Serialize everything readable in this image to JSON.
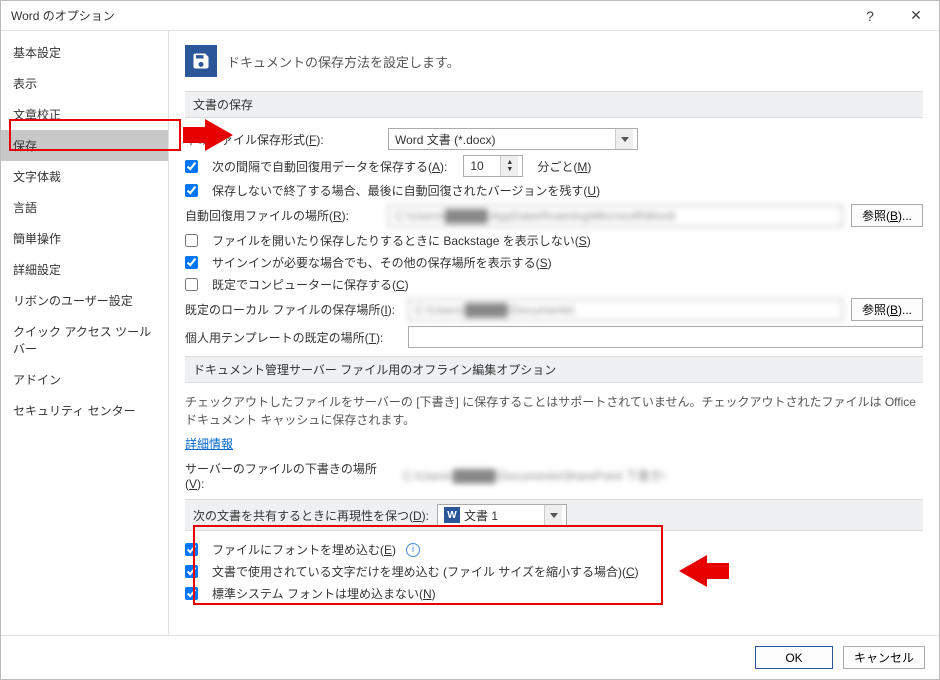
{
  "window": {
    "title": "Word のオプション",
    "help_tooltip": "?",
    "close_tooltip": "✕"
  },
  "sidebar": {
    "items": [
      "基本設定",
      "表示",
      "文章校正",
      "保存",
      "文字体裁",
      "言語",
      "簡単操作",
      "詳細設定",
      "リボンのユーザー設定",
      "クイック アクセス ツール バー",
      "アドイン",
      "セキュリティ センター"
    ],
    "selected_index": 3
  },
  "header": {
    "text": "ドキュメントの保存方法を設定します。"
  },
  "section_save": {
    "title": "文書の保存",
    "file_format_label_pre": "準のファイル保存形式(",
    "file_format_hot": "F",
    "file_format_label_post": "):",
    "file_format_value": "Word 文書 (*.docx)",
    "autorecover_label_pre": "次の間隔で自動回復用データを保存する(",
    "autorecover_hot": "A",
    "autorecover_label_post": "):",
    "autorecover_value": "10",
    "autorecover_unit_pre": "分ごと(",
    "autorecover_unit_hot": "M",
    "autorecover_unit_post": ")",
    "keep_last_label_pre": "保存しないで終了する場合、最後に自動回復されたバージョンを残す(",
    "keep_last_hot": "U",
    "keep_last_post": ")",
    "autorecover_loc_label_pre": "自動回復用ファイルの場所(",
    "autorecover_loc_hot": "R",
    "autorecover_loc_post": "):",
    "autorecover_loc_value": "C:\\Users\\█████\\AppData\\Roaming\\Microsoft\\Word\\",
    "browse_btn_pre": "参照(",
    "browse_btn_hot": "B",
    "browse_btn_post": ")...",
    "backstage_label_pre": "ファイルを開いたり保存したりするときに Backstage を表示しない(",
    "backstage_hot": "S",
    "backstage_post": ")",
    "signin_label_pre": "サインインが必要な場合でも、その他の保存場所を表示する(",
    "signin_hot": "S",
    "signin_post": ")",
    "save_computer_label_pre": "既定でコンピューターに保存する(",
    "save_computer_hot": "C",
    "save_computer_post": ")",
    "default_loc_label_pre": "既定のローカル ファイルの保存場所(",
    "default_loc_hot": "I",
    "default_loc_post": "):",
    "default_loc_value": "C:\\Users\\█████\\Documents\\",
    "template_loc_label_pre": "個人用テンプレートの既定の場所(",
    "template_loc_hot": "T",
    "template_loc_post": "):"
  },
  "section_server": {
    "title": "ドキュメント管理サーバー ファイル用のオフライン編集オプション",
    "desc": "チェックアウトしたファイルをサーバーの [下書き] に保存することはサポートされていません。チェックアウトされたファイルは Office ドキュメント キャッシュに保存されます。",
    "more_info": "詳細情報",
    "server_loc_label_pre": "サーバーのファイルの下書きの場所(",
    "server_loc_hot": "V",
    "server_loc_post": "):",
    "server_loc_value": "C:\\Users\\█████\\Documents\\SharePoint 下書き\\"
  },
  "section_share": {
    "title_pre": "次の文書を共有するときに再現性を保つ(",
    "title_hot": "D",
    "title_post": "):",
    "doc_value": "文書 1",
    "embed_fonts_pre": "ファイルにフォントを埋め込む(",
    "embed_fonts_hot": "E",
    "embed_fonts_post": ")",
    "embed_used_only_pre": "文書で使用されている文字だけを埋め込む (ファイル サイズを縮小する場合)(",
    "embed_used_only_hot": "C",
    "embed_used_only_post": ")",
    "no_sys_fonts_pre": "標準システム フォントは埋め込まない(",
    "no_sys_fonts_hot": "N",
    "no_sys_fonts_post": ")"
  },
  "footer": {
    "ok": "OK",
    "cancel": "キャンセル"
  }
}
